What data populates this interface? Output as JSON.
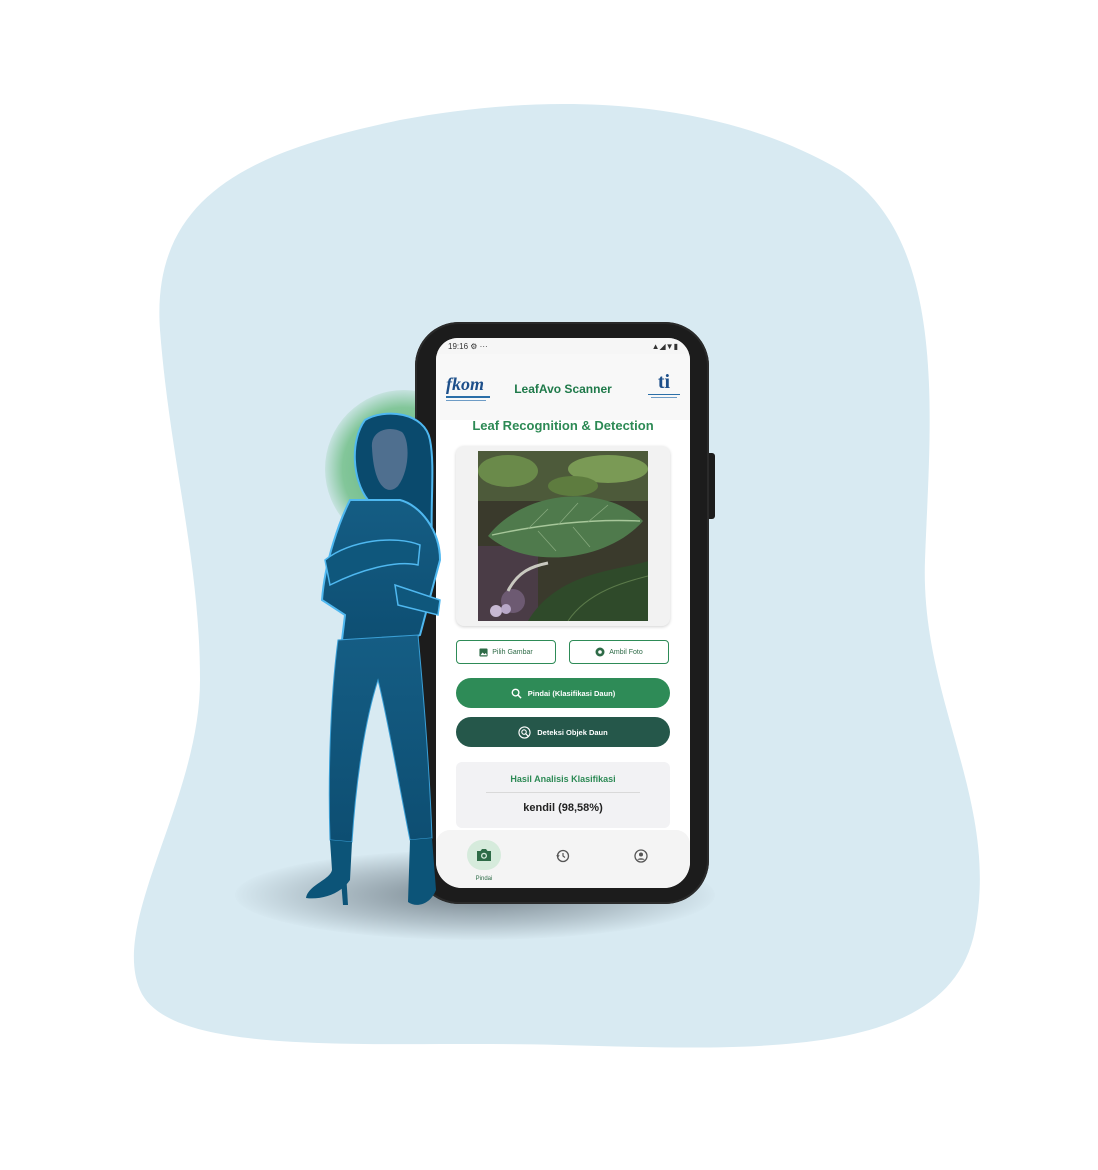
{
  "colors": {
    "blob": "#d8eaf2",
    "brand_green": "#2e8b57",
    "dark_green": "#25574a",
    "figure_blue": "#0f5f86",
    "glow_green": "#5fb37a"
  },
  "phone": {
    "status_bar": {
      "time": "19:16",
      "left_icons": "⚙ ···",
      "right_icons": "▲◢▼▮"
    },
    "header": {
      "left_logo_text": "fkom",
      "app_title": "LeafAvo Scanner",
      "right_logo_text": "ti"
    },
    "page_title": "Leaf Recognition & Detection",
    "buttons": {
      "pick_image": "Pilih Gambar",
      "take_photo": "Ambil Foto",
      "scan": "Pindai (Klasifikasi Daun)",
      "detect": "Deteksi Objek Daun"
    },
    "result": {
      "title": "Hasil Analisis Klasifikasi",
      "value": "kendil (98,58%)"
    },
    "bottom_nav": {
      "items": [
        {
          "icon": "camera-icon",
          "label": "Pindai",
          "active": true
        },
        {
          "icon": "history-icon",
          "label": "",
          "active": false
        },
        {
          "icon": "account-icon",
          "label": "",
          "active": false
        }
      ]
    }
  }
}
